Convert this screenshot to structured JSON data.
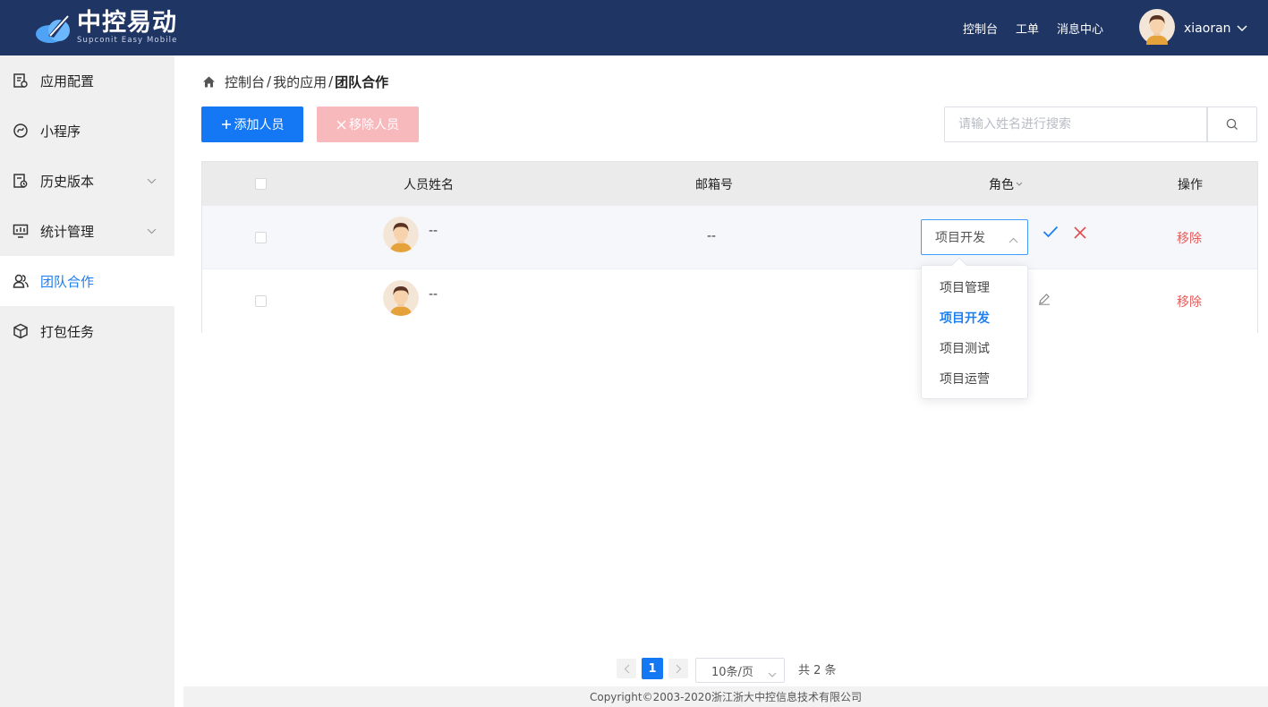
{
  "header": {
    "logo_title": "中控易动",
    "logo_subtitle": "Supconit Easy Mobile",
    "nav": [
      "控制台",
      "工单",
      "消息中心"
    ],
    "username": "xiaoran",
    "bg_color": "#1f3564"
  },
  "sidebar": {
    "items": [
      {
        "label": "应用配置",
        "icon": "app-config-icon",
        "has_arrow": false
      },
      {
        "label": "小程序",
        "icon": "mini-program-icon",
        "has_arrow": false
      },
      {
        "label": "历史版本",
        "icon": "history-version-icon",
        "has_arrow": true
      },
      {
        "label": "统计管理",
        "icon": "statistics-icon",
        "has_arrow": true
      },
      {
        "label": "团队合作",
        "icon": "team-icon",
        "has_arrow": false,
        "active": true
      },
      {
        "label": "打包任务",
        "icon": "package-icon",
        "has_arrow": false
      }
    ]
  },
  "breadcrumb": {
    "items": [
      "控制台",
      "我的应用"
    ],
    "separator": "/",
    "current": "团队合作"
  },
  "toolbar": {
    "add_label": "添加人员",
    "remove_label": "移除人员",
    "search_placeholder": "请输入姓名进行搜索",
    "accent_color": "#1478f5"
  },
  "table": {
    "columns": [
      "人员姓名",
      "邮箱号",
      "角色",
      "操作"
    ],
    "rows": [
      {
        "name": "--",
        "email": "--",
        "role": "项目开发",
        "editing": true,
        "action": "移除"
      },
      {
        "name": "--",
        "email": "",
        "role": "",
        "editing": false,
        "action": "移除"
      }
    ]
  },
  "role_dropdown": {
    "options": [
      "项目管理",
      "项目开发",
      "项目测试",
      "项目运营"
    ],
    "selected": "项目开发"
  },
  "pagination": {
    "current_page": "1",
    "page_size": "10条/页",
    "total_text": "共 2 条"
  },
  "footer": {
    "copyright": "Copyright©2003-2020浙江浙大中控信息技术有限公司"
  }
}
